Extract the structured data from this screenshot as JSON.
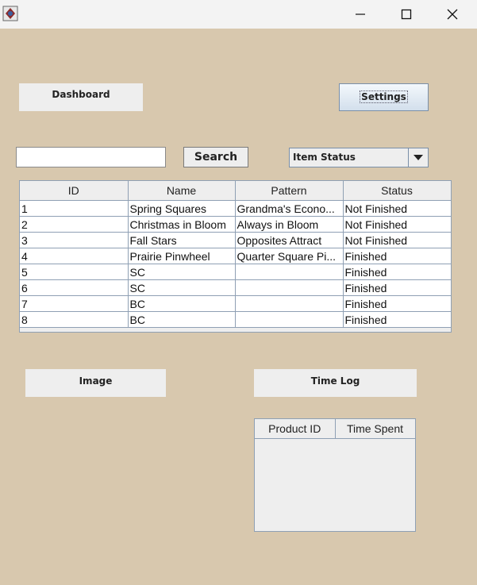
{
  "window": {
    "app_icon": "java-app-icon"
  },
  "buttons": {
    "dashboard": "Dashboard",
    "settings": "Settings",
    "search": "Search",
    "image": "Image",
    "time_log": "Time Log"
  },
  "search": {
    "value": ""
  },
  "status_filter": {
    "selected": "Item Status"
  },
  "items_table": {
    "columns": [
      "ID",
      "Name",
      "Pattern",
      "Status"
    ],
    "rows": [
      [
        "1",
        "Spring Squares",
        "Grandma's Econo...",
        "Not Finished"
      ],
      [
        "2",
        "Christmas in Bloom",
        "Always in Bloom",
        "Not Finished"
      ],
      [
        "3",
        "Fall Stars",
        "Opposites Attract",
        "Not Finished"
      ],
      [
        "4",
        "Prairie Pinwheel",
        "Quarter Square Pi...",
        "Finished"
      ],
      [
        "5",
        "SC",
        "",
        "Finished"
      ],
      [
        "6",
        "SC",
        "",
        "Finished"
      ],
      [
        "7",
        "BC",
        "",
        "Finished"
      ],
      [
        "8",
        "BC",
        "",
        "Finished"
      ]
    ]
  },
  "time_table": {
    "columns": [
      "Product ID",
      "Time Spent"
    ],
    "rows": []
  }
}
